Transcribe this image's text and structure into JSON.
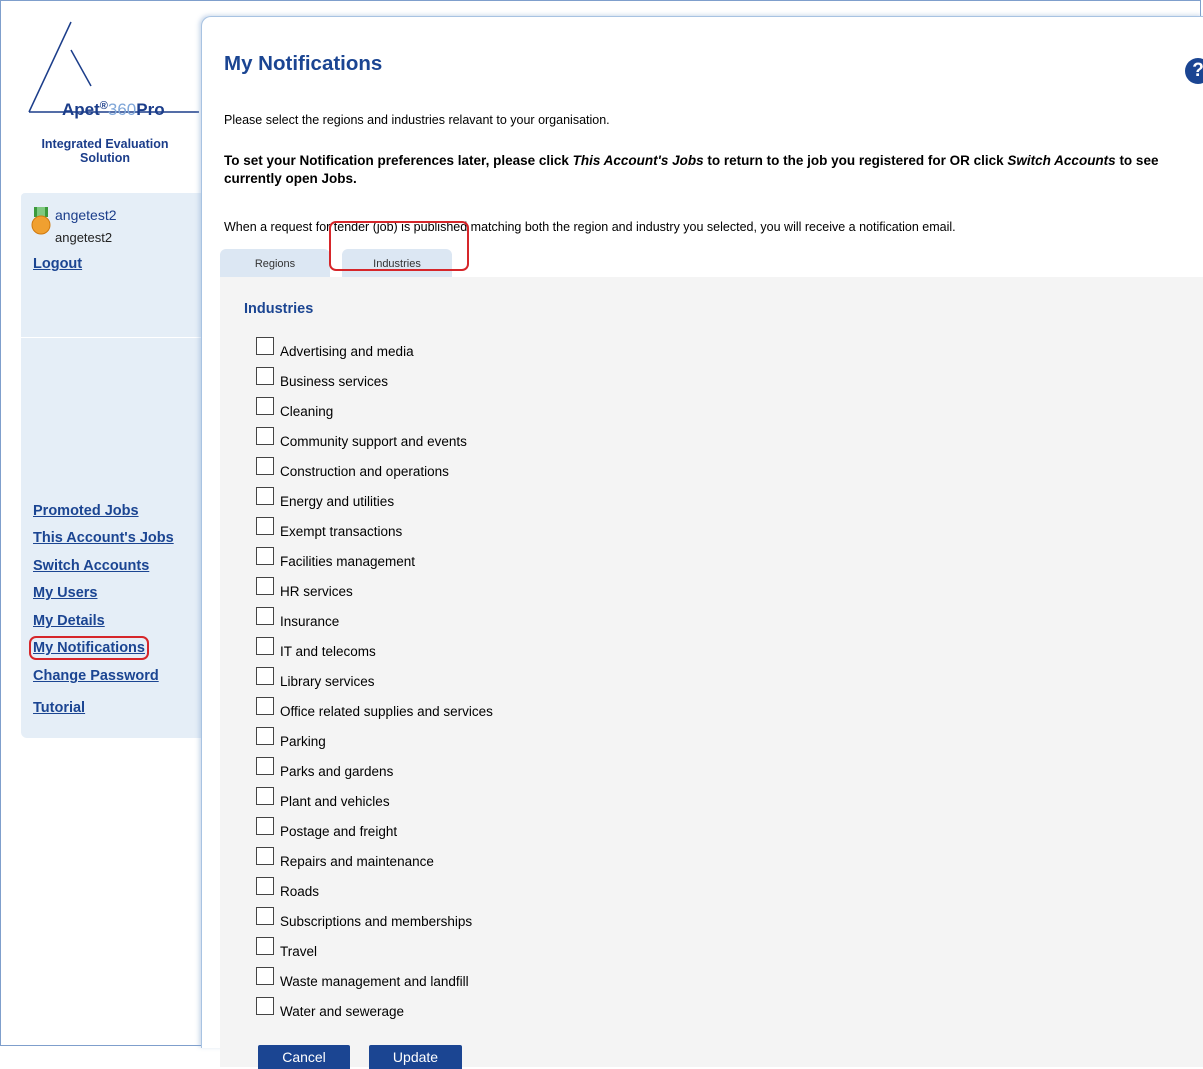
{
  "logo": {
    "brand": "Apet",
    "reg": "®",
    "num": "360",
    "pro": "Pro",
    "subtitle": "Integrated Evaluation Solution"
  },
  "user": {
    "name": "angetest2",
    "account": "angetest2",
    "logout": "Logout"
  },
  "nav": {
    "items": [
      "Promoted Jobs",
      "This Account's Jobs",
      "Switch Accounts",
      "My Users",
      "My Details",
      "My Notifications",
      "Change Password",
      "Tutorial"
    ],
    "active": "My Notifications"
  },
  "page": {
    "title": "My Notifications",
    "help": "?",
    "intro": "Please select the regions and industries relavant to your organisation.",
    "later_prefix": "To set your Notification preferences later, please click ",
    "later_link1": "This Account's Jobs",
    "later_mid": " to return to the job you registered for OR click ",
    "later_link2": "Switch Accounts",
    "later_suffix": " to see currently open Jobs.",
    "notice": "When a request for tender (job) is published matching both the region and industry you selected, you will receive a notification email."
  },
  "tabs": {
    "regions": "Regions",
    "industries": "Industries",
    "active": "Industries"
  },
  "industries": {
    "title": "Industries",
    "items": [
      "Advertising and media",
      "Business services",
      "Cleaning",
      "Community support and events",
      "Construction and operations",
      "Energy and utilities",
      "Exempt transactions",
      "Facilities management",
      "HR services",
      "Insurance",
      "IT and telecoms",
      "Library services",
      "Office related supplies and services",
      "Parking",
      "Parks and gardens",
      "Plant and vehicles",
      "Postage and freight",
      "Repairs and maintenance",
      "Roads",
      "Subscriptions and memberships",
      "Travel",
      "Waste management and landfill",
      "Water and sewerage"
    ]
  },
  "buttons": {
    "cancel": "Cancel",
    "update": "Update"
  },
  "colors": {
    "accent": "#1b4592",
    "highlight": "#d6262a",
    "sidebar_bg": "#e5eef7",
    "content_bg": "#f4f4f4"
  }
}
